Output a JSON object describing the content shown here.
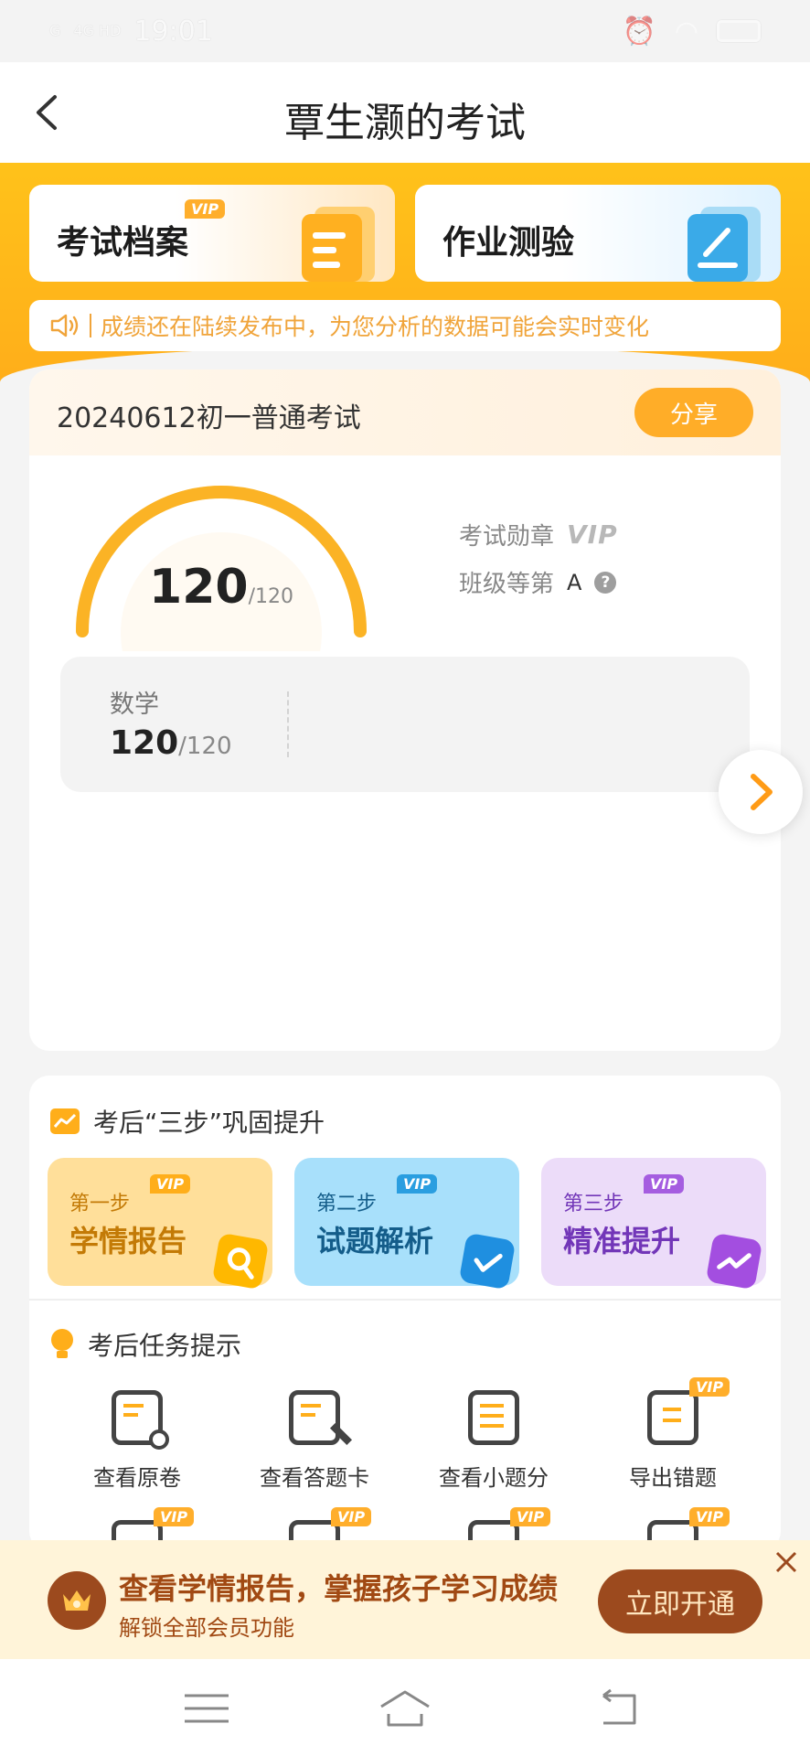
{
  "status": {
    "time": "19:01",
    "signal1": "G",
    "signal2": "4G HD"
  },
  "header": {
    "title": "覃生灏的考试"
  },
  "top_cards": {
    "archive": {
      "label": "考试档案",
      "vip": "VIP"
    },
    "homework": {
      "label": "作业测验"
    }
  },
  "notice": {
    "text": "成绩还在陆续发布中，为您分析的数据可能会实时变化"
  },
  "exam": {
    "name": "20240612初一普通考试",
    "share_label": "分享",
    "score": "120",
    "score_total": "/120",
    "score_progress": 1.0,
    "medal_label": "考试勋章",
    "medal_value": "VIP",
    "rank_label": "班级等第",
    "rank_value": "A",
    "help": "?",
    "subjects": [
      {
        "name": "数学",
        "score": "120",
        "total": "/120"
      }
    ]
  },
  "steps_section": {
    "title": "考后“三步”巩固提升",
    "steps": [
      {
        "step": "第一步",
        "name": "学情报告",
        "vip": "VIP"
      },
      {
        "step": "第二步",
        "name": "试题解析",
        "vip": "VIP"
      },
      {
        "step": "第三步",
        "name": "精准提升",
        "vip": "VIP"
      }
    ]
  },
  "tasks_section": {
    "title": "考后任务提示",
    "tasks": [
      {
        "label": "查看原卷"
      },
      {
        "label": "查看答题卡"
      },
      {
        "label": "查看小题分"
      },
      {
        "label": "导出错题",
        "vip": "VIP"
      }
    ],
    "more_vip": [
      "VIP",
      "VIP",
      "VIP",
      "VIP"
    ]
  },
  "promo": {
    "title": "查看学情报告，掌握孩子学习成绩",
    "subtitle": "解锁全部会员功能",
    "button": "立即开通"
  },
  "colors": {
    "accent": "#ffae1a",
    "promo_brown": "#9c4a1e"
  }
}
